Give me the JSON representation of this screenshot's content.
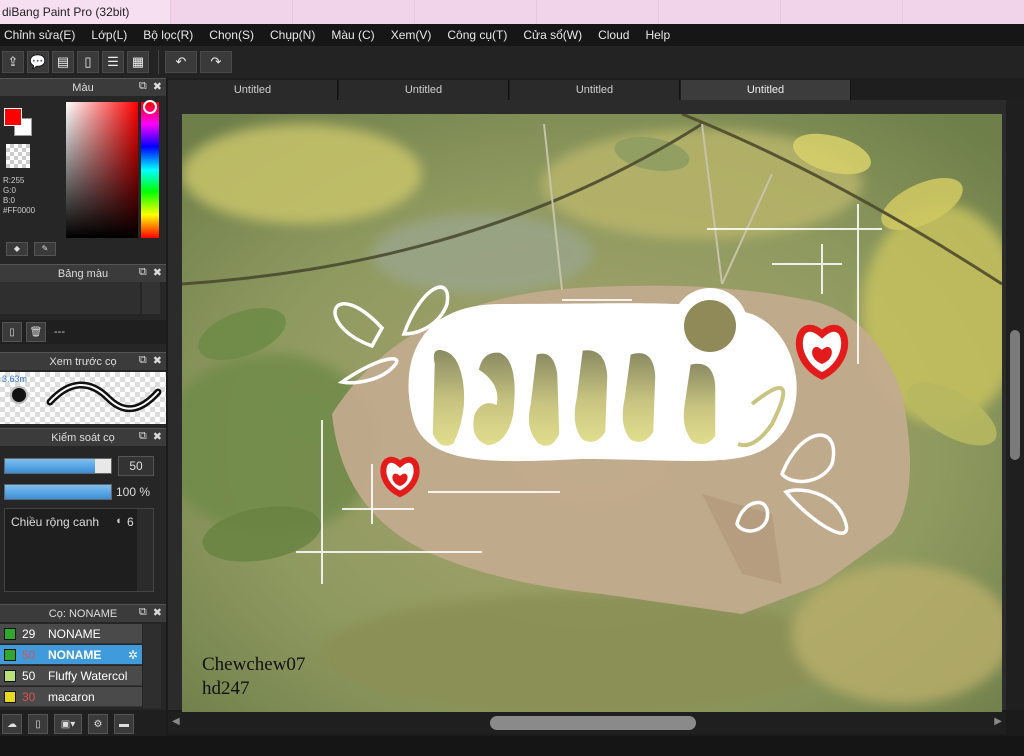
{
  "window": {
    "title": "diBang Paint Pro (32bit)"
  },
  "menu": {
    "items": [
      "Chỉnh sửa(E)",
      "Lớp(L)",
      "Bộ lọc(R)",
      "Chọn(S)",
      "Chụp(N)",
      "Màu (C)",
      "Xem(V)",
      "Công cụ(T)",
      "Cửa sổ(W)",
      "Cloud",
      "Help"
    ]
  },
  "tabs": [
    "Untitled",
    "Untitled",
    "Untitled",
    "Untitled"
  ],
  "panels": {
    "color": {
      "title": "Màu",
      "readout": [
        "R:255",
        "G:0",
        "B:0",
        "#FF0000"
      ],
      "primary_color": "#ff0000",
      "secondary_color": "#ffffff"
    },
    "palette": {
      "title": "Bảng màu",
      "dash": "---"
    },
    "preview": {
      "title": "Xem trước cọ",
      "size": "3.63m"
    },
    "brush_control": {
      "title": "Kiểm soát cọ",
      "size_value": "50",
      "size_fraction": 0.85,
      "opacity_value": "100 %",
      "opacity_fraction": 1.0,
      "edge_label": "Chiều rộng canh",
      "edge_value": "6"
    },
    "layers": {
      "title": "Cọ: NONAME",
      "rows": [
        {
          "opacity": "29",
          "name": "NONAME",
          "color": "#2ea82e",
          "selected": false,
          "red": false
        },
        {
          "opacity": "50",
          "name": "NONAME",
          "color": "#2ea82e",
          "selected": true,
          "red": true
        },
        {
          "opacity": "50",
          "name": "Fluffy Watercol",
          "color": "#b8e07a",
          "selected": false,
          "red": false
        },
        {
          "opacity": "30",
          "name": "macaron",
          "color": "#e8d820",
          "selected": false,
          "red": true
        }
      ]
    }
  },
  "canvas": {
    "signature_line1": "Chewchew07",
    "signature_line2": "hd247"
  },
  "colors": {
    "accent": "#3f9bdc",
    "heart": "#e41b1b",
    "lettering": "#d7d28a"
  }
}
